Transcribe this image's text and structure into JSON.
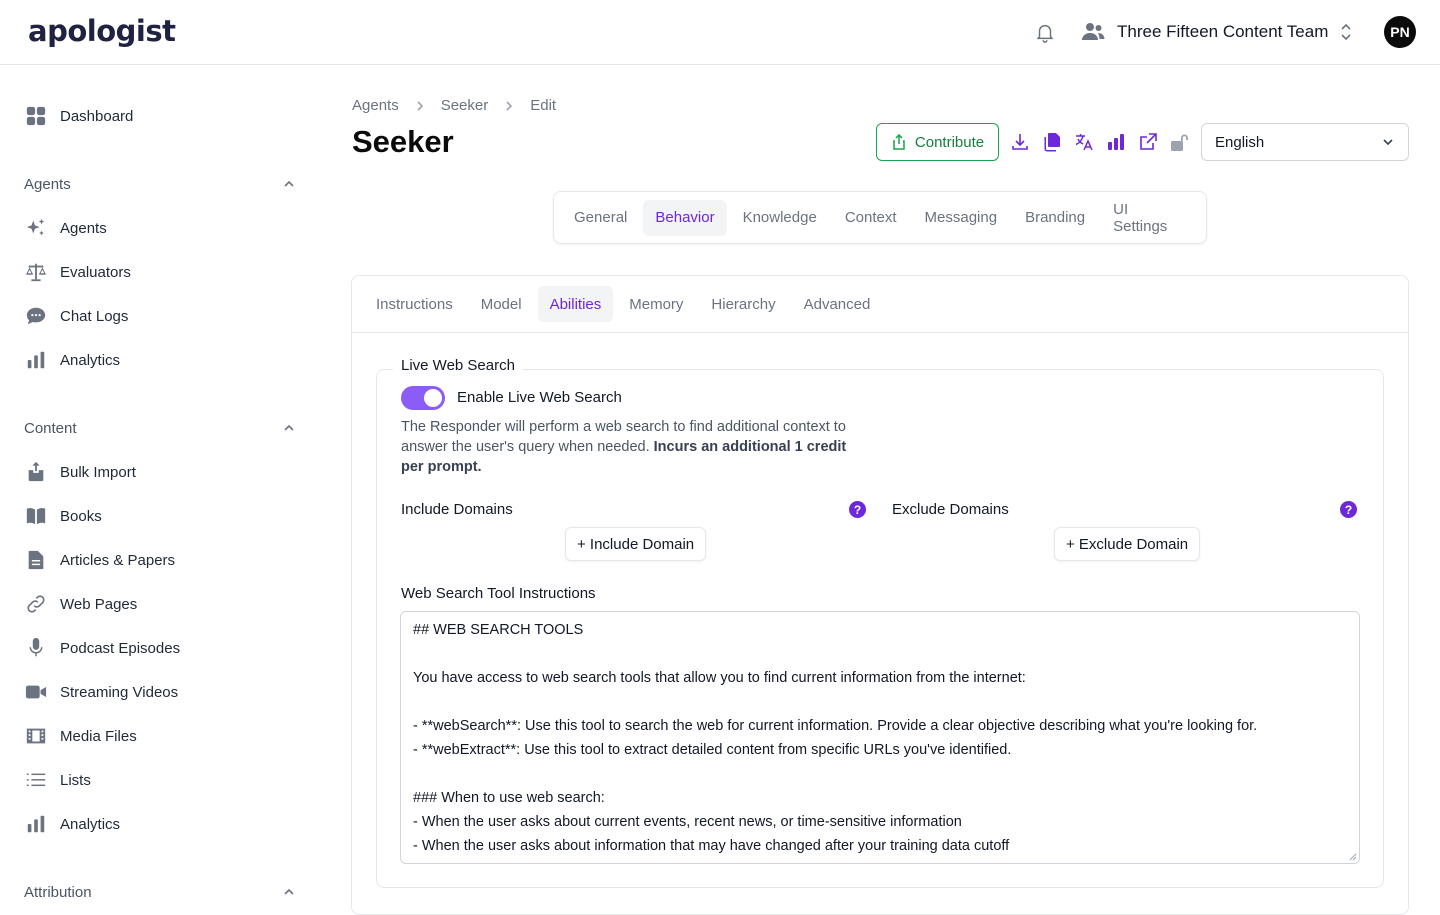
{
  "header": {
    "logo_text": "apologist",
    "team_name": "Three Fifteen Content Team",
    "avatar_initials": "PN"
  },
  "sidebar": {
    "top_item": {
      "label": "Dashboard",
      "icon": "dashboard-icon"
    },
    "sections": [
      {
        "title": "Agents",
        "items": [
          {
            "label": "Agents",
            "icon": "sparkles-icon"
          },
          {
            "label": "Evaluators",
            "icon": "scale-icon"
          },
          {
            "label": "Chat Logs",
            "icon": "chat-bubble-icon"
          },
          {
            "label": "Analytics",
            "icon": "bar-chart-icon"
          }
        ]
      },
      {
        "title": "Content",
        "items": [
          {
            "label": "Bulk Import",
            "icon": "upload-icon"
          },
          {
            "label": "Books",
            "icon": "book-icon"
          },
          {
            "label": "Articles & Papers",
            "icon": "document-icon"
          },
          {
            "label": "Web Pages",
            "icon": "link-icon"
          },
          {
            "label": "Podcast Episodes",
            "icon": "microphone-icon"
          },
          {
            "label": "Streaming Videos",
            "icon": "video-camera-icon"
          },
          {
            "label": "Media Files",
            "icon": "film-icon"
          },
          {
            "label": "Lists",
            "icon": "list-icon"
          },
          {
            "label": "Analytics",
            "icon": "bar-chart-icon"
          }
        ]
      },
      {
        "title": "Attribution",
        "items": []
      }
    ]
  },
  "breadcrumb": [
    "Agents",
    "Seeker",
    "Edit"
  ],
  "page_title": "Seeker",
  "toolbar": {
    "contribute_label": "Contribute",
    "language_selected": "English"
  },
  "primary_tabs": {
    "items": [
      "General",
      "Behavior",
      "Knowledge",
      "Context",
      "Messaging",
      "Branding",
      "UI Settings"
    ],
    "active": "Behavior"
  },
  "secondary_tabs": {
    "items": [
      "Instructions",
      "Model",
      "Abilities",
      "Memory",
      "Hierarchy",
      "Advanced"
    ],
    "active": "Abilities"
  },
  "web_search": {
    "legend": "Live Web Search",
    "toggle_label": "Enable Live Web Search",
    "toggle_on": true,
    "description_plain": "The Responder will perform a web search to find additional context to answer the user's query when needed.",
    "description_bold": "Incurs an additional 1 credit per prompt.",
    "include_label": "Include Domains",
    "include_button": "+ Include Domain",
    "exclude_label": "Exclude Domains",
    "exclude_button": "+ Exclude Domain",
    "help_glyph": "?",
    "instructions_label": "Web Search Tool Instructions",
    "instructions_lines": [
      "## WEB SEARCH TOOLS",
      "",
      "You have access to web search tools that allow you to find current information from the internet:",
      "",
      "- **webSearch**: Use this tool to search the web for current information. Provide a clear objective describing what you're looking for.",
      "- **webExtract**: Use this tool to extract detailed content from specific URLs you've identified.",
      "",
      "### When to use web search:",
      "- When the user asks about current events, recent news, or time-sensitive information",
      "- When the user asks about information that may have changed after your training data cutoff"
    ]
  },
  "colors": {
    "accent": "#6d28d9",
    "toggle_on": "#8b5cf6",
    "contribute_green": "#16a34a"
  }
}
